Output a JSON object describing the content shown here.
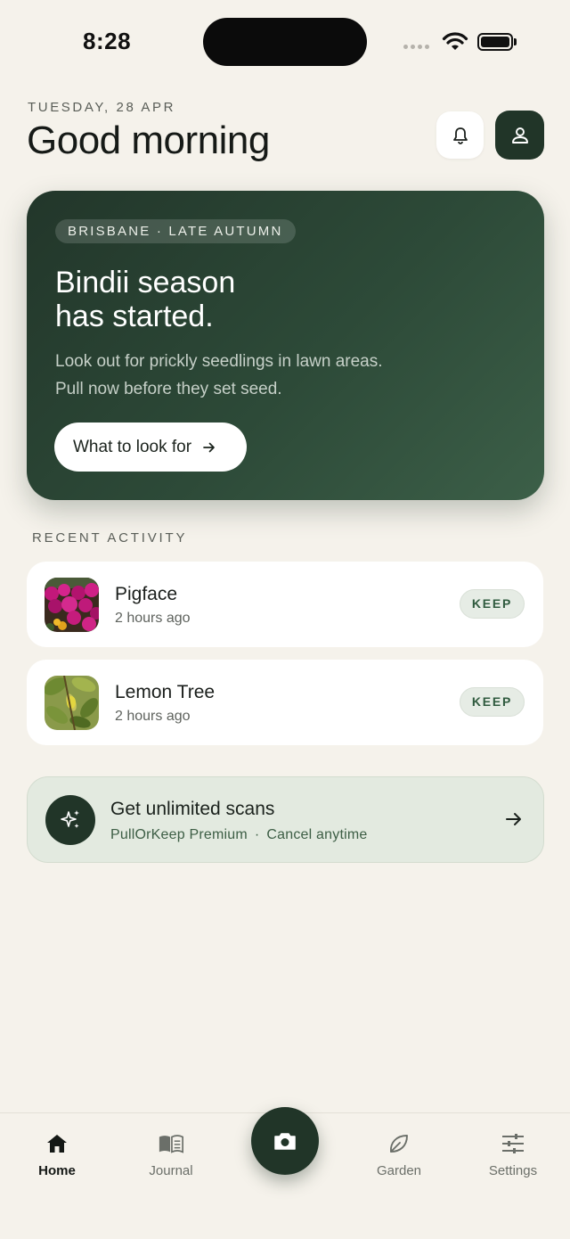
{
  "status_bar": {
    "time": "8:28"
  },
  "header": {
    "date": "TUESDAY, 28 APR",
    "greeting": "Good morning"
  },
  "hero": {
    "tag": "BRISBANE · LATE AUTUMN",
    "title_line1": "Bindii season",
    "title_line2": "has started.",
    "body": "Look out for prickly seedlings in lawn areas. Pull now before they set seed.",
    "cta_label": "What to look for"
  },
  "recent_activity": {
    "section_label": "RECENT ACTIVITY",
    "items": [
      {
        "name": "Pigface",
        "time": "2 hours ago",
        "verdict": "KEEP",
        "thumb_icon": "pigface-flowers-photo"
      },
      {
        "name": "Lemon Tree",
        "time": "2 hours ago",
        "verdict": "KEEP",
        "thumb_icon": "lemon-tree-leaves-photo"
      }
    ]
  },
  "premium": {
    "title": "Get unlimited scans",
    "product": "PullOrKeep Premium",
    "separator": "·",
    "note": "Cancel anytime"
  },
  "tab_bar": {
    "tabs": [
      {
        "label": "Home",
        "icon": "home-icon",
        "active": true
      },
      {
        "label": "Journal",
        "icon": "book-icon",
        "active": false
      },
      {
        "label": "Garden",
        "icon": "leaf-icon",
        "active": false
      },
      {
        "label": "Settings",
        "icon": "sliders-icon",
        "active": false
      }
    ],
    "center_action_icon": "camera-icon"
  },
  "colors": {
    "background": "#f5f2eb",
    "brand_dark": "#213528",
    "keep_badge_text": "#2f5a3e",
    "premium_bg": "#e3eae0"
  }
}
